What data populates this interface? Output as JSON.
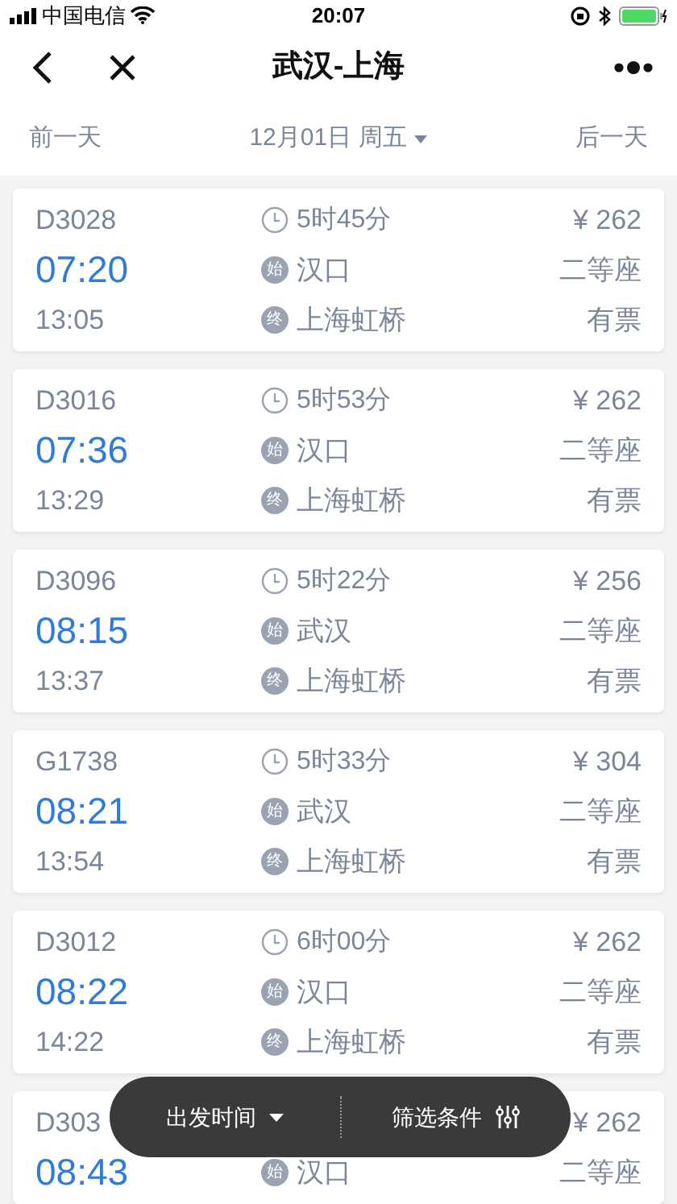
{
  "status_bar": {
    "carrier": "中国电信",
    "time": "20:07"
  },
  "nav": {
    "title": "武汉-上海"
  },
  "date_bar": {
    "prev": "前一天",
    "date": "12月01日 周五",
    "next": "后一天"
  },
  "trains": [
    {
      "number": "D3028",
      "depart": "07:20",
      "arrive": "13:05",
      "duration": "5时45分",
      "from_badge": "始",
      "from": "汉口",
      "to_badge": "终",
      "to": "上海虹桥",
      "price": "¥ 262",
      "seat": "二等座",
      "availability": "有票"
    },
    {
      "number": "D3016",
      "depart": "07:36",
      "arrive": "13:29",
      "duration": "5时53分",
      "from_badge": "始",
      "from": "汉口",
      "to_badge": "终",
      "to": "上海虹桥",
      "price": "¥ 262",
      "seat": "二等座",
      "availability": "有票"
    },
    {
      "number": "D3096",
      "depart": "08:15",
      "arrive": "13:37",
      "duration": "5时22分",
      "from_badge": "始",
      "from": "武汉",
      "to_badge": "终",
      "to": "上海虹桥",
      "price": "¥ 256",
      "seat": "二等座",
      "availability": "有票"
    },
    {
      "number": "G1738",
      "depart": "08:21",
      "arrive": "13:54",
      "duration": "5时33分",
      "from_badge": "始",
      "from": "武汉",
      "to_badge": "终",
      "to": "上海虹桥",
      "price": "¥ 304",
      "seat": "二等座",
      "availability": "有票"
    },
    {
      "number": "D3012",
      "depart": "08:22",
      "arrive": "14:22",
      "duration": "6时00分",
      "from_badge": "始",
      "from": "汉口",
      "to_badge": "终",
      "to": "上海虹桥",
      "price": "¥ 262",
      "seat": "二等座",
      "availability": "有票"
    },
    {
      "number": "D303",
      "depart": "08:43",
      "from_badge": "始",
      "from": "汉口",
      "price": "¥ 262",
      "seat": "二等座"
    }
  ],
  "toolbar": {
    "sort": "出发时间",
    "filter": "筛选条件"
  }
}
